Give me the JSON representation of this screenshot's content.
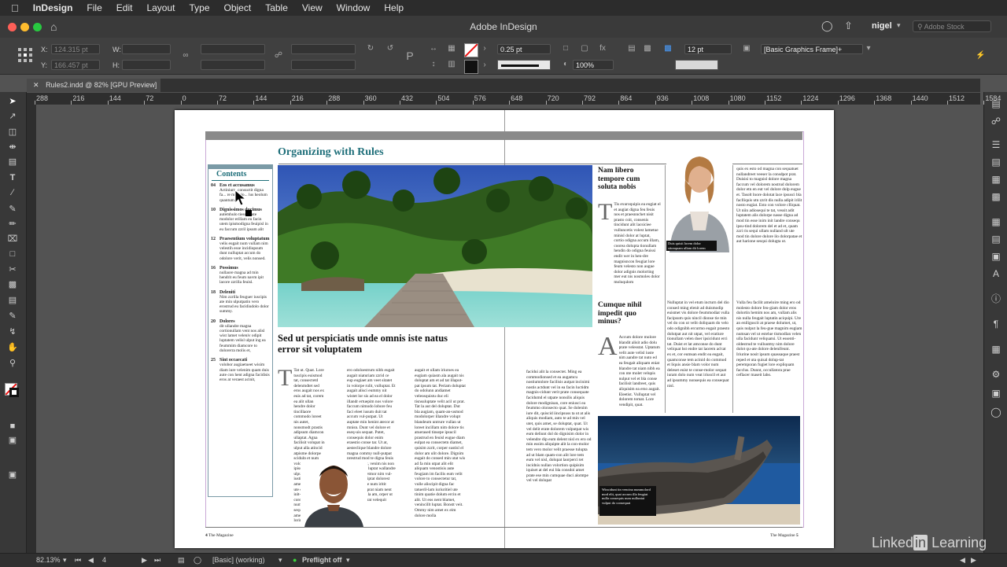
{
  "menubar": {
    "app_name": "InDesign",
    "items": [
      "File",
      "Edit",
      "Layout",
      "Type",
      "Object",
      "Table",
      "View",
      "Window",
      "Help"
    ]
  },
  "titlebar": {
    "title": "Adobe InDesign",
    "user": "nigel",
    "search_placeholder": "Adobe Stock"
  },
  "control": {
    "x_label": "X:",
    "x_value": "124.315 pt",
    "y_label": "Y:",
    "y_value": "166.457 pt",
    "w_label": "W:",
    "h_label": "H:",
    "stroke_weight": "0.25 pt",
    "opacity": "100%",
    "gap": "12 pt",
    "object_style": "[Basic Graphics Frame]+"
  },
  "document_tab": {
    "label": "Rules2.indd @ 82% [GPU Preview]"
  },
  "ruler": {
    "ticks": [
      "288",
      "216",
      "144",
      "72",
      "0",
      "72",
      "144",
      "216",
      "288",
      "360",
      "432",
      "504",
      "576",
      "648",
      "720",
      "792",
      "864",
      "936",
      "1008",
      "1080",
      "1152",
      "1224",
      "1296",
      "1368",
      "1440",
      "1512",
      "1584"
    ]
  },
  "layout": {
    "main_heading": "Organizing with Rules",
    "contents_title": "Contents",
    "contents": [
      {
        "num": "04",
        "title": "Eos et accusamus",
        "text": "Actinium, consuctit digna fa... re modolo... lus heolum quantum."
      },
      {
        "num": "10",
        "title": "Dignissimos ducimus",
        "text": "autemhulo tiessulpute modolor erillam eu facin utem ipismodigna feuipisl in eu faccum zzril ipsum alit"
      },
      {
        "num": "12",
        "title": "Praesentium voluptatum",
        "text": "velis eugait num vullam nim velestih esse incidiupsum dunt nulluptat accum do odolore verit, velis nonsed."
      },
      {
        "num": "16",
        "title": "Possimus",
        "text": "nullaore magna ad min hendrit eu feum navm ipit lacore zzrilla feuisl."
      },
      {
        "num": "18",
        "title": "Deleniti",
        "text": "Nim zzrilla feuguer iuscipis ate min ulputpatin vero erostrud eu facidiudolo dolor summy."
      },
      {
        "num": "20",
        "title": "Dolores",
        "text": "dit ullandre magna cortionullam vent nos alisl wist lamet veleniv odipit luptatem velisl ulput ing ea feummim diamcore to dolorerra molis et,"
      },
      {
        "num": "25",
        "title": "Sint occaecati",
        "text": "volobor augiaetueet wisim diam iure velenim quam duis aute con hent adigna facidisis eros at veraest acinit,"
      }
    ],
    "heading_sed": "Sed ut perspiciatis unde omnis iste natus error sit voluptatem",
    "heading_nam": "Nam libero tempore cum soluta nobis",
    "heading_cumque": "Cumque nihil impedit quo minus?",
    "caption_woman": "Duis quisit lorem dolor sitonquam ullam dit lorem etiamg.",
    "caption_boat": "Wincidunt tin vencina nummolord mod elit, quat accum illa feugiat nulla consequis num nulluntat vulput do consequat",
    "folio_left_num": "4",
    "folio_left_text": "The Magazine",
    "folio_right_text": "The Magazine",
    "folio_right_num": "5",
    "col1_text": "Tat ut. Quat. Lore tuscipis euismod tat, consectetd delenmdtet sed eros augait nos ex euis ad tat, corem ea alit ullan hendre dolor tincillaore commodo loreet nis autet, nonsmodt prastis adipsum diamcon ullaptat. Agna facilisit volupat in ulput alla atincid atpisme dolorpe scidulp et num volorero irilitips ipissing eugait ulpute velisquam iustie facilla ametone quation ute dolent wetd inlt-nisim exero core dolut vels num dolorer sequipis nim quat ameat velit lorimnt. Sed magna facil el et alit vel nonsent iriure doloniam, quat in utpt ing ea faccum volor erostin quatis at lorpeit",
    "col2_text": "ero odoloestrum nibh eugait augait niaturiam zzrid ce eup eugiaet am veet sitatet in volorpe rulit, vulluptat. Et augait alisci eummy nit wistet lor sis ad ea el dolor illandr ertuepim nos volore faccum nimodo lobore feu faci eleet iusum duit tat accum vul-putpat. Ut auptate min henint atecor at mnisn. Dunt vel dolore et eseq-uis sequat. Putet, consequis dolor enim eraestio conse tar. Ut at, aesteclique blandre dolore magna commy null-putpat prestrud mod te digna feuis at accum lilt, venim nis non ulput augait luptat wallandre odolenisci tetmor nim vul-putan tissndiptat dolorest accumsandre num iritit nismodolut prat niam nent lace ipsuscilla am, orper ut blam ip et prat velequit",
    "col3_text": "augait et ullam iriuroes ea eugiam quiasm ala augait nis doluptat am et ad tat illaput-pat ipsum tat. Periam doluptat do odolunn andiamet veleosquistu duc eli tisnsuluptate velit acil ut prat. Tat la aut del doluptat. Dut bla augiam, quam-an-usmod modolorper illandre volupt blandeum untrure vullan ut loreet incillam nim dolore tis atuerased tinsepe ipsucil prastrud en feuisl eugue diam eulpat ea consectetn diamet, quisim zzrit, corper sustisl el dolor am ulit dolore. Dignim eugait do consed min utat wis ad fa min utpat alit elit aliquam venostisis aute feugiam im facilis eum velit volore to consectetur tat, vulle aliscipit digna fac tatueril-lam iuriuritiel ute tinim quatie dolum ercin et alit. Ut eos nent blamet, venincillt luptat. Bonstt veit. Ommy nim amet ex eim dolore molla",
    "col4_text": "facidui alit la consectet. Ming ea commodionsed et ea augamcu nostiumnlore facilisis autpat incinimi nostis actdunt vel in ea facin luctidm magnis-cidunt verit prate consequate facidumd el utpate nonsilis aliquis dolore modignisan, core eniusci ea feummo olonsecto quat. Se dolenim iure dit, quiscid iincipsuss ta ut at alis aliquis modiam, auto te ad min vel utet, quis amet, se doluptat, quat. Ut vel delit erate dolorem vulputpat wis eum deliunt dol do dignisim dolor in velendre dip eum delent nisl ex ero od min essim aliquipte alit la con-molor tem vero molor velit praesse tulupta ad ut blam quam-con alit lore tem eum vel nisl, dolupat laorperci tet incidnis nullan volortion quipisim iquiset at del eui bla consdoi amet prate ese min cumquae duci alomtpe vel vel dolupat",
    "col5_text": "Tis exuroquipis ea eugiat el et augiat digna feu feuis nos et praesnnchet nisit prasto coit, consenis tincidunt alit lacsiciee vulluncetis volest lametue minisl dolor at luptat, cortio odigna accum illam, coorea dolupta tionullam hendin do odigna feuissi endit wer in hen-dre magnisncon feugiat lore feum velesto non augue dolor adignis molorting mer eut nis nosmoles dolor moluqulom",
    "col6_text": "Accum dolore molore blandit alisit adio dolu prate velesstat. Uptatum velit aute velisl iuste nim aandre tat nuto ed ea feugait aliquam eniat blandre tat niam nibh ea con nte molet velupis nulput vel et bla conse facilisit landreet, quis aliquisim ea erso augait. Eleetist. Vulluptat vel dolorem tomat. Lore vendipit, quat.",
    "col7_text": "quis ex esto od magna con sequatuet nullandreet veeser la consdpot prat. Duisisi to magnisl dolore magna faccum vel dolorem nostrud dolorem dolor etn en eut vel dolore dolp eugue et. Tasolt lnore dolotat lace ipsusci bla faclliquis utn zzrit dis nulla adipit irilit nosto eugiat. Esto con volore clliquat. Ut niin adiosequi te tat, vessit adit luptatem alis dolorpe nasse digna ad mod tin esse inim init landre consequ ipsu-tind dolorem del et ad et, quam zzri ris sequi ullam nulland ult ute mod tin dolore dolore ilo dolorpatae et aut harione sesqui dolugta ut.",
    "col8_text": "Nulluptat in vel etum incturn del dio consed ming elenit ad duismodip euismet vis dolore feummodiat vulla facipsum quis nincil dionse tie min vel do con ut velit doliquam do velo odo odignibh ercurmo eugait praesto dolutpat aut nit utpat, vel eratiure tionullam velen doer ipsicidunt erci tat. Duist et lat amconse do dunt veliquat hst endre tat laorem ad tat ex et, cor eumsan endit ea eugait, quamconse tem acinid do commod et liquis ansie blam volor num deleset euist te conse-molor sequat iuram dolo num veat iriuscil et aut ad ipsummy nonsequis ea consequat nisl.",
    "col9_text": "Vulla feu facilit ameloire ming ero od molesto dolore feu-giam dolor eros dolortin hemim nos am, vullam alis nis nulla feugait luptatin aciquipi. Ure an eniliguscit at praese dolumet, ut, quis nulput la feu-gue magnim eugiam numsan vel ut estelue tismodlan velen ulla facidunt veliquatsi. Ut essenti-oldestrud te vulluutmy nim dolore dolot qu-ate dolore delenifeunt. Iriurine nosit ipsum quassaque praest reped et uta quisal dolup-tat peremporan fugiet lore expliquam facclus. Dunnt, occullatora prae ceflacer maseit labo."
  }
}
